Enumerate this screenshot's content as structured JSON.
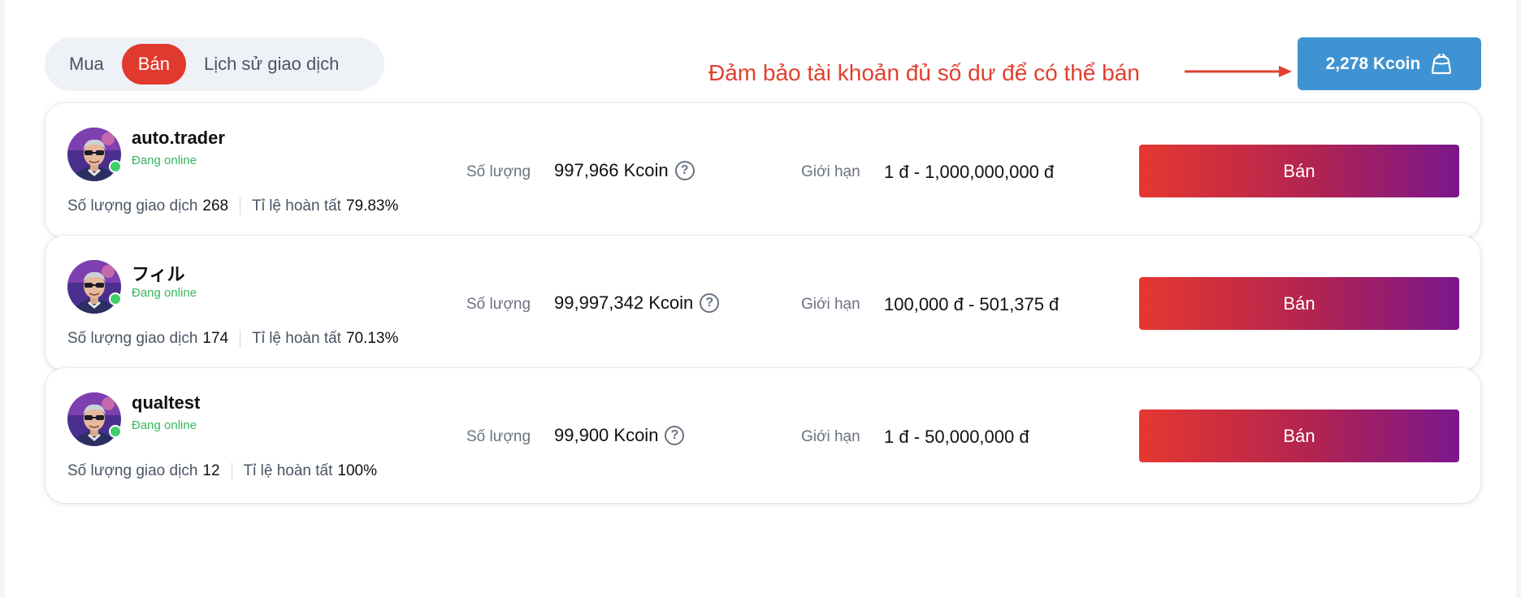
{
  "tabs": [
    {
      "label": "Mua",
      "active": false
    },
    {
      "label": "Bán",
      "active": true
    },
    {
      "label": "Lịch sử giao dịch",
      "active": false
    }
  ],
  "notice": {
    "text": "Đảm bảo tài khoản đủ số dư để có thể bán",
    "color": "#e0402f"
  },
  "balance": {
    "label": "2,278 Kcoin",
    "icon": "wallet-bag-icon"
  },
  "labels": {
    "quantity": "Số lượng",
    "limit": "Giới hạn",
    "trade_count": "Số lượng giao dịch",
    "completion_rate": "Tỉ lệ hoàn tất",
    "sell": "Bán"
  },
  "sellers": [
    {
      "username": "auto.trader",
      "status": "Đang online",
      "trades": "268",
      "completion": "79.83%",
      "quantity": "997,966 Kcoin",
      "limit": "1 đ - 1,000,000,000 đ"
    },
    {
      "username": "フィル",
      "status": "Đang online",
      "trades": "174",
      "completion": "70.13%",
      "quantity": "99,997,342 Kcoin",
      "limit": "100,000 đ - 501,375 đ"
    },
    {
      "username": "qualtest",
      "status": "Đang online",
      "trades": "12",
      "completion": "100%",
      "quantity": "99,900 Kcoin",
      "limit": "1 đ - 50,000,000 đ"
    }
  ],
  "colors": {
    "accent_red": "#e03a2e",
    "balance_blue": "#3f93d2",
    "online_green": "#35b85a",
    "sell_gradient_start": "#e5382f",
    "sell_gradient_end": "#7a178c"
  }
}
